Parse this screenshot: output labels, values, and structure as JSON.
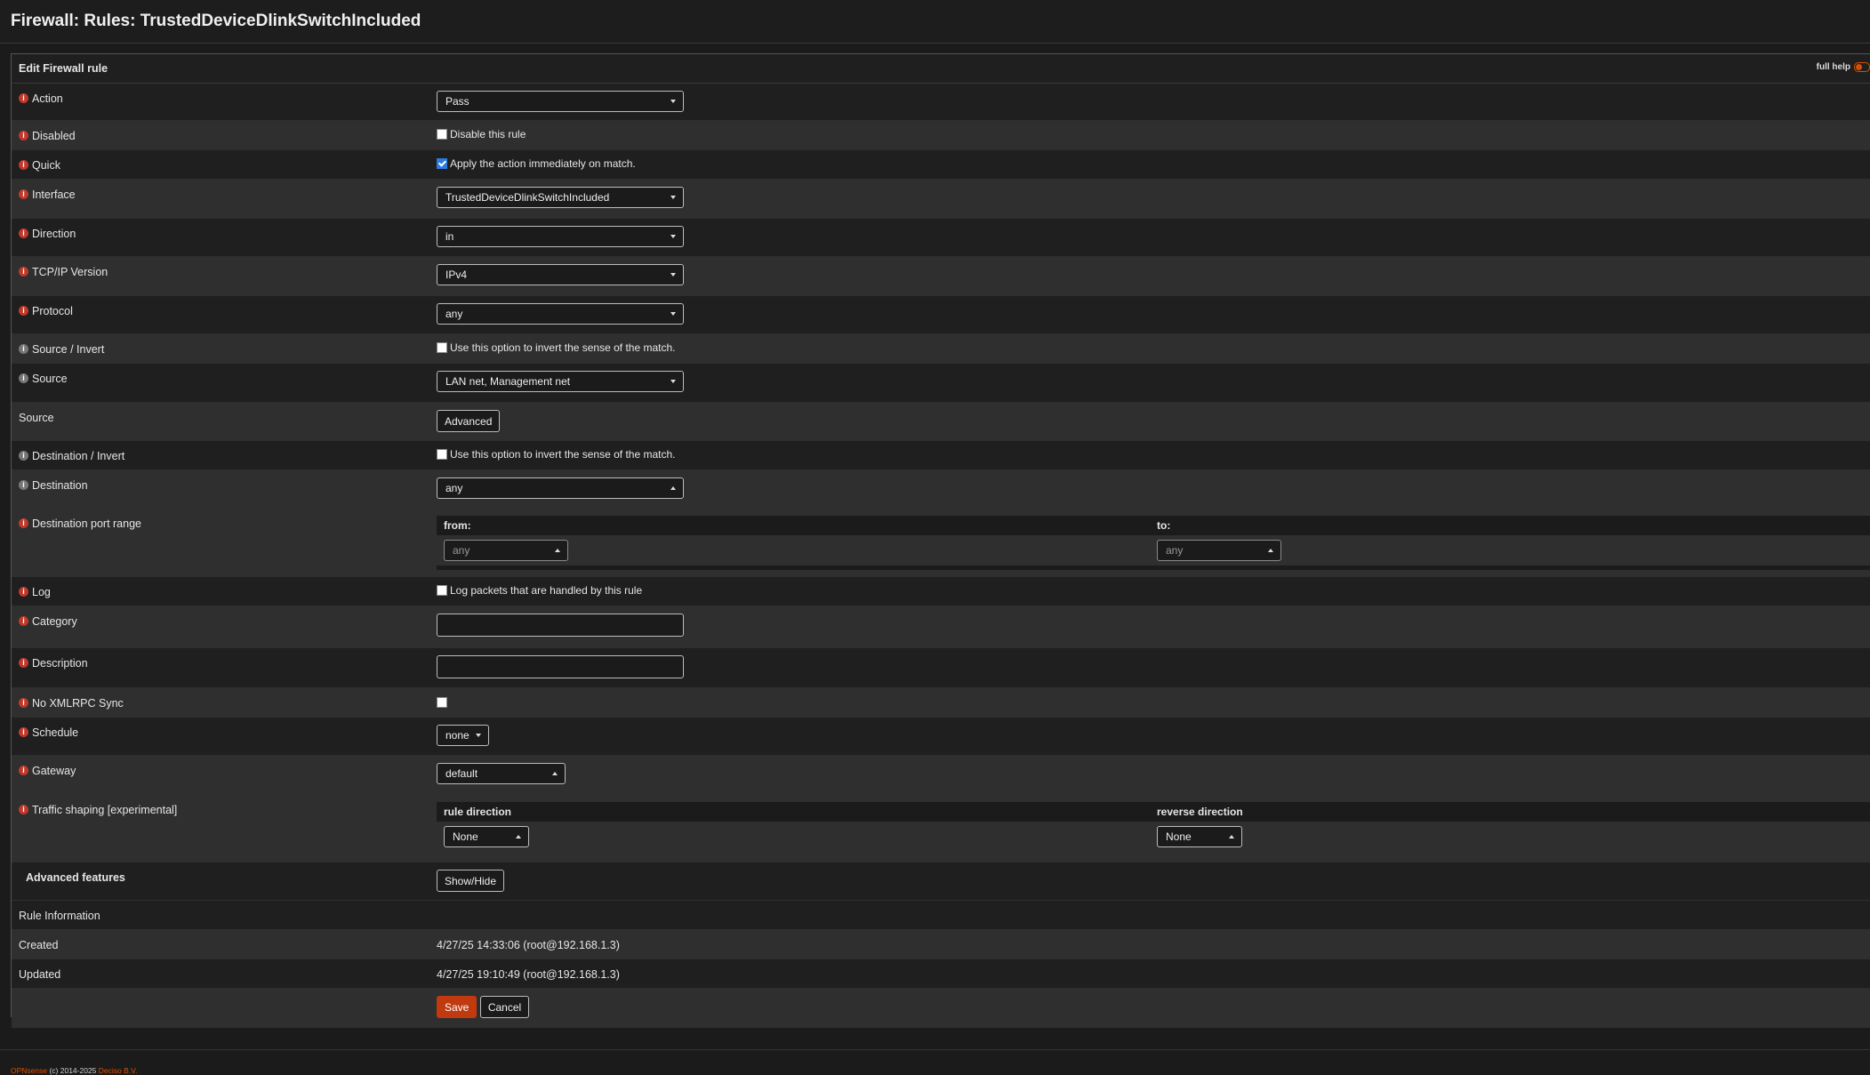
{
  "page": {
    "title": "Firewall: Rules: TrustedDeviceDlinkSwitchIncluded"
  },
  "panel": {
    "title": "Edit Firewall rule",
    "full_help_label": "full help"
  },
  "fields": {
    "action": {
      "label": "Action",
      "value": "Pass"
    },
    "disabled": {
      "label": "Disabled",
      "checkbox_label": "Disable this rule",
      "checked": false
    },
    "quick": {
      "label": "Quick",
      "checkbox_label": "Apply the action immediately on match.",
      "checked": true
    },
    "interface": {
      "label": "Interface",
      "value": "TrustedDeviceDlinkSwitchIncluded"
    },
    "direction": {
      "label": "Direction",
      "value": "in"
    },
    "ip_version": {
      "label": "TCP/IP Version",
      "value": "IPv4"
    },
    "protocol": {
      "label": "Protocol",
      "value": "any"
    },
    "source_invert": {
      "label": "Source / Invert",
      "checkbox_label": "Use this option to invert the sense of the match.",
      "checked": false
    },
    "source": {
      "label": "Source",
      "value": "LAN net, Management net"
    },
    "source_advanced": {
      "label": "Source",
      "button_label": "Advanced"
    },
    "destination_invert": {
      "label": "Destination / Invert",
      "checkbox_label": "Use this option to invert the sense of the match.",
      "checked": false
    },
    "destination": {
      "label": "Destination",
      "value": "any"
    },
    "dest_port_range": {
      "label": "Destination port range",
      "from_label": "from:",
      "to_label": "to:",
      "from_value": "any",
      "to_value": "any"
    },
    "log": {
      "label": "Log",
      "checkbox_label": "Log packets that are handled by this rule",
      "checked": false
    },
    "category": {
      "label": "Category",
      "value": ""
    },
    "description": {
      "label": "Description",
      "value": ""
    },
    "no_xmlrpc_sync": {
      "label": "No XMLRPC Sync",
      "checked": false
    },
    "schedule": {
      "label": "Schedule",
      "value": "none"
    },
    "gateway": {
      "label": "Gateway",
      "value": "default"
    },
    "traffic_shaping": {
      "label": "Traffic shaping [experimental]",
      "rule_direction_label": "rule direction",
      "reverse_direction_label": "reverse direction",
      "rule_direction_value": "None",
      "reverse_direction_value": "None"
    },
    "advanced_features": {
      "label": "Advanced features",
      "button_label": "Show/Hide"
    }
  },
  "rule_info": {
    "label": "Rule Information",
    "created_label": "Created",
    "created_value": "4/27/25 14:33:06 (root@192.168.1.3)",
    "updated_label": "Updated",
    "updated_value": "4/27/25 19:10:49 (root@192.168.1.3)"
  },
  "actions": {
    "save_label": "Save",
    "cancel_label": "Cancel"
  },
  "footer": {
    "brand": "OPNsense",
    "copyright": " (c) 2014-2025 ",
    "company": "Deciso B.V."
  },
  "colors": {
    "accent": "#d94f00",
    "primary_button": "#c0390f",
    "info_icon": "#c0392b"
  }
}
